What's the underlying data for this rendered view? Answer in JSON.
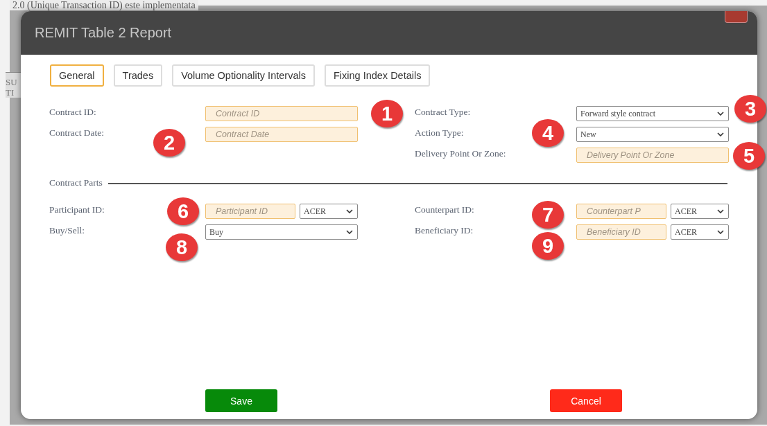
{
  "background_page": {
    "heading": "2.0 (Unique Transaction ID) este implementata",
    "side_texts": [
      "SU",
      "TI"
    ]
  },
  "dialog": {
    "title": "REMIT Table 2 Report",
    "close_button": {
      "kind": "close"
    }
  },
  "tabs": [
    {
      "label": "General",
      "selected": true
    },
    {
      "label": "Trades",
      "selected": false
    },
    {
      "label": "Volume Optionality Intervals",
      "selected": false
    },
    {
      "label": "Fixing Index Details",
      "selected": false
    }
  ],
  "general_fields": {
    "left": [
      {
        "label": "Contract ID:",
        "kind": "input",
        "placeholder": "Contract ID"
      },
      {
        "label": "Contract Date:",
        "kind": "input",
        "placeholder": "Contract Date"
      }
    ],
    "right": [
      {
        "label": "Contract Type:",
        "kind": "select",
        "value": "Forward style contract"
      },
      {
        "label": "Action Type:",
        "kind": "select",
        "value": "New"
      },
      {
        "label": "Delivery Point Or Zone:",
        "kind": "input",
        "placeholder": "Delivery Point Or Zone"
      }
    ]
  },
  "contract_parts": {
    "title": "Contract Parts",
    "left": [
      {
        "label": "Participant ID:",
        "kind": "input_select",
        "placeholder": "Participant ID",
        "value": "ACER"
      },
      {
        "label": "Buy/Sell:",
        "kind": "select",
        "value": "Buy"
      }
    ],
    "right": [
      {
        "label": "Counterpart ID:",
        "kind": "input_select",
        "placeholder": "Counterpart P",
        "value": "ACER"
      },
      {
        "label": "Beneficiary ID:",
        "kind": "input_select",
        "placeholder": "Beneficiary ID",
        "value": "ACER"
      }
    ]
  },
  "buttons": [
    {
      "label": "Save",
      "kind": "save"
    },
    {
      "label": "Cancel",
      "kind": "cancel"
    }
  ],
  "annotations": [
    "1",
    "2",
    "3",
    "4",
    "5",
    "6",
    "7",
    "8",
    "9"
  ]
}
